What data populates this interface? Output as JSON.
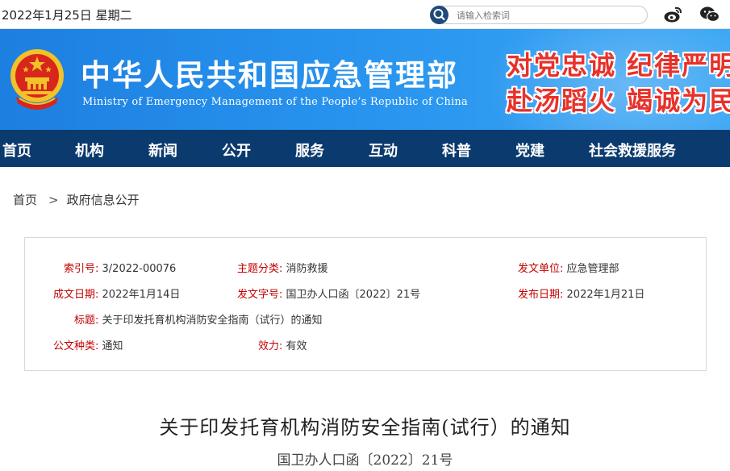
{
  "topbar": {
    "date": "2022年1月25日 星期二",
    "search_placeholder": "请输入检索词",
    "icons": [
      "search-icon",
      "weibo-icon",
      "wechat-icon"
    ]
  },
  "banner": {
    "title": "中华人民共和国应急管理部",
    "subtitle": "Ministry of Emergency Management of the People’s Republic of China",
    "slogan_line1": "对党忠诚 纪律严明",
    "slogan_line2": "赴汤蹈火 竭诚为民",
    "colors": {
      "banner": "#2792ee",
      "slogan": "#e8312a",
      "nav": "#0a3a6e",
      "meta_key": "#c00000"
    }
  },
  "nav": [
    "首页",
    "机构",
    "新闻",
    "公开",
    "服务",
    "互动",
    "科普",
    "党建",
    "社会救援服务"
  ],
  "breadcrumb": {
    "home": "首页",
    "separator": ">",
    "current": "政府信息公开"
  },
  "meta": {
    "index_label": "索引号:",
    "index_value": "3/2022-00076",
    "topic_label": "主题分类:",
    "topic_value": "消防救援",
    "issuer_label": "发文单位:",
    "issuer_value": "应急管理部",
    "created_label": "成文日期:",
    "created_value": "2022年1月14日",
    "docno_label": "发文字号:",
    "docno_value": "国卫办人口函〔2022〕21号",
    "published_label": "发布日期:",
    "published_value": "2022年1月21日",
    "title_label": "标题:",
    "title_value": "关于印发托育机构消防安全指南（试行）的通知",
    "type_label": "公文种类:",
    "type_value": "通知",
    "validity_label": "效力:",
    "validity_value": "有效"
  },
  "article": {
    "title": "关于印发托育机构消防安全指南(试行）的通知",
    "doc_number": "国卫办人口函〔2022〕21号"
  }
}
